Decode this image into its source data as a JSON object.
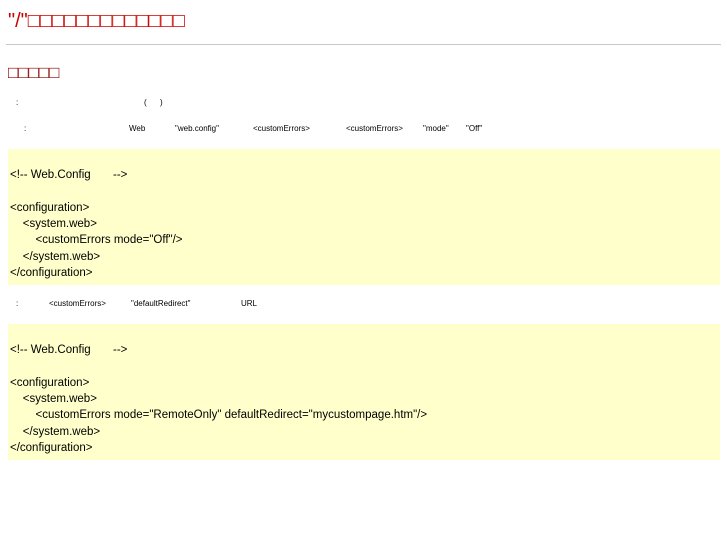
{
  "header": {
    "title": "\"/\"□□□□□□□□□□□□□",
    "section_title": "□□□□□"
  },
  "description": {
    "line1": {
      "label": ":",
      "paren": "(      )"
    },
    "line2": {
      "label": ":",
      "web": "Web",
      "web_config": "\"web.config\"",
      "custom_errors_1": "<customErrors>",
      "custom_errors_2": "<customErrors>",
      "mode": "\"mode\"",
      "off": "\"Off\""
    },
    "line3": {
      "label": ":",
      "custom_errors": "<customErrors>",
      "default_redirect": "\"defaultRedirect\"",
      "url": "URL"
    }
  },
  "code_block_1": {
    "lines": [
      "<!-- Web.Config       -->",
      "",
      "<configuration>",
      "    <system.web>",
      "        <customErrors mode=\"Off\"/>",
      "    </system.web>",
      "</configuration>"
    ]
  },
  "code_block_2": {
    "lines": [
      "<!-- Web.Config       -->",
      "",
      "<configuration>",
      "    <system.web>",
      "        <customErrors mode=\"RemoteOnly\" defaultRedirect=\"mycustompage.htm\"/>",
      "    </system.web>",
      "</configuration>"
    ]
  },
  "colors": {
    "title": "#cc0000",
    "section_title": "#8b0000",
    "code_background": "#ffffcc",
    "rule": "#c8c8c8"
  }
}
